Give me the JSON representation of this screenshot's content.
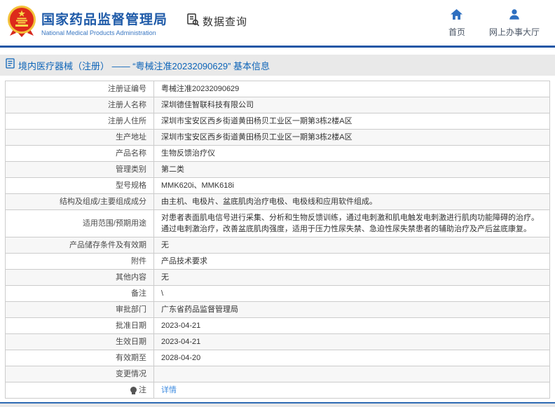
{
  "header": {
    "org_name_cn": "国家药品监督管理局",
    "org_name_en": "National Medical Products Administration",
    "data_query_label": "数据查询",
    "nav": [
      {
        "label": "首页",
        "icon": "home-icon"
      },
      {
        "label": "网上办事大厅",
        "icon": "person-icon"
      }
    ]
  },
  "breadcrumb": {
    "text": "境内医疗器械（注册） —— “粤械注准20232090629” 基本信息",
    "icon": "document-icon"
  },
  "table": {
    "rows": [
      {
        "label": "注册证编号",
        "value": "粤械注准20232090629"
      },
      {
        "label": "注册人名称",
        "value": "深圳德佳智联科技有限公司"
      },
      {
        "label": "注册人住所",
        "value": "深圳市宝安区西乡街道黄田杨贝工业区一期第3栋2楼A区"
      },
      {
        "label": "生产地址",
        "value": "深圳市宝安区西乡街道黄田杨贝工业区一期第3栋2楼A区"
      },
      {
        "label": "产品名称",
        "value": "生物反馈治疗仪"
      },
      {
        "label": "管理类别",
        "value": "第二类"
      },
      {
        "label": "型号规格",
        "value": "MMK620i、MMK618i"
      },
      {
        "label": "结构及组成/主要组成成分",
        "value": "由主机、电极片、盆底肌肉治疗电极、电极线和应用软件组成。"
      },
      {
        "label": "适用范围/预期用途",
        "value": "对患者表面肌电信号进行采集、分析和生物反馈训练，通过电刺激和肌电触发电刺激进行肌肉功能障碍的治疗。通过电刺激治疗，改善盆底肌肉强度，适用于压力性尿失禁、急迫性尿失禁患者的辅助治疗及产后盆底康复。"
      },
      {
        "label": "产品储存条件及有效期",
        "value": "无"
      },
      {
        "label": "附件",
        "value": "产品技术要求"
      },
      {
        "label": "其他内容",
        "value": "无"
      },
      {
        "label": "备注",
        "value": "\\"
      },
      {
        "label": "审批部门",
        "value": "广东省药品监督管理局"
      },
      {
        "label": "批准日期",
        "value": "2023-04-21"
      },
      {
        "label": "生效日期",
        "value": "2023-04-21"
      },
      {
        "label": "有效期至",
        "value": "2028-04-20"
      },
      {
        "label": "变更情况",
        "value": ""
      },
      {
        "label": "注",
        "label_icon": "bulb-icon",
        "value": "详情",
        "link": true
      }
    ]
  },
  "colors": {
    "brand_blue": "#1e5aa8",
    "header_rule_blue": "#2257a5",
    "link_blue": "#3f8ce0",
    "breadcrumb_text_blue": "#0d64b8",
    "bar_gray": "#e9e9e9",
    "row_alt_gray": "#f7f7f7",
    "table_border": "#cccccc",
    "emblem_red": "#dd2a1b",
    "emblem_gold": "#f3c23a",
    "text_dark": "#333333"
  }
}
